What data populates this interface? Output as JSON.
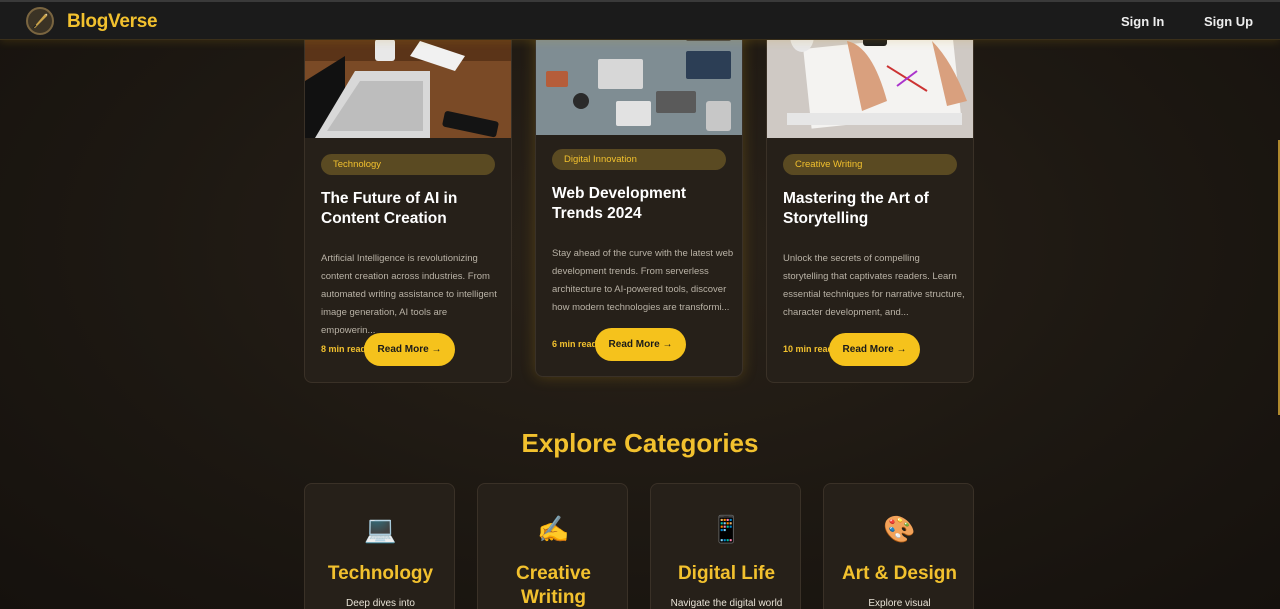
{
  "nav": {
    "brand": "BlogVerse",
    "sign_in": "Sign In",
    "sign_up": "Sign Up"
  },
  "posts": [
    {
      "tag": "Technology",
      "title": "The Future of AI in Content Creation",
      "excerpt": "Artificial Intelligence is revolutionizing content creation across industries. From automated writing assistance to intelligent image generation, AI tools are empowerin...",
      "read_time": "8 min read",
      "button": "Read More →"
    },
    {
      "tag": "Digital Innovation",
      "title": "Web Development Trends 2024",
      "excerpt": "Stay ahead of the curve with the latest web development trends. From serverless architecture to AI-powered tools, discover how modern technologies are transformi...",
      "read_time": "6 min read",
      "button": "Read More →"
    },
    {
      "tag": "Creative Writing",
      "title": "Mastering the Art of Storytelling",
      "excerpt": "Unlock the secrets of compelling storytelling that captivates readers. Learn essential techniques for narrative structure, character development, and...",
      "read_time": "10 min read",
      "button": "Read More →"
    }
  ],
  "categories_section": {
    "title": "Explore Categories",
    "items": [
      {
        "icon": "laptop-icon",
        "glyph": "💻",
        "name": "Technology",
        "desc": "Deep dives into"
      },
      {
        "icon": "writing-hand-icon",
        "glyph": "✍️",
        "name": "Creative Writing",
        "desc": ""
      },
      {
        "icon": "mobile-phone-icon",
        "glyph": "📱",
        "name": "Digital Life",
        "desc": "Navigate the digital world"
      },
      {
        "icon": "palette-icon",
        "glyph": "🎨",
        "name": "Art & Design",
        "desc": "Explore visual"
      }
    ]
  },
  "colors": {
    "accent": "#f2c12e",
    "button": "#f5c21c",
    "card_bg": "#262019",
    "tag_bg": "#5a4a22"
  }
}
